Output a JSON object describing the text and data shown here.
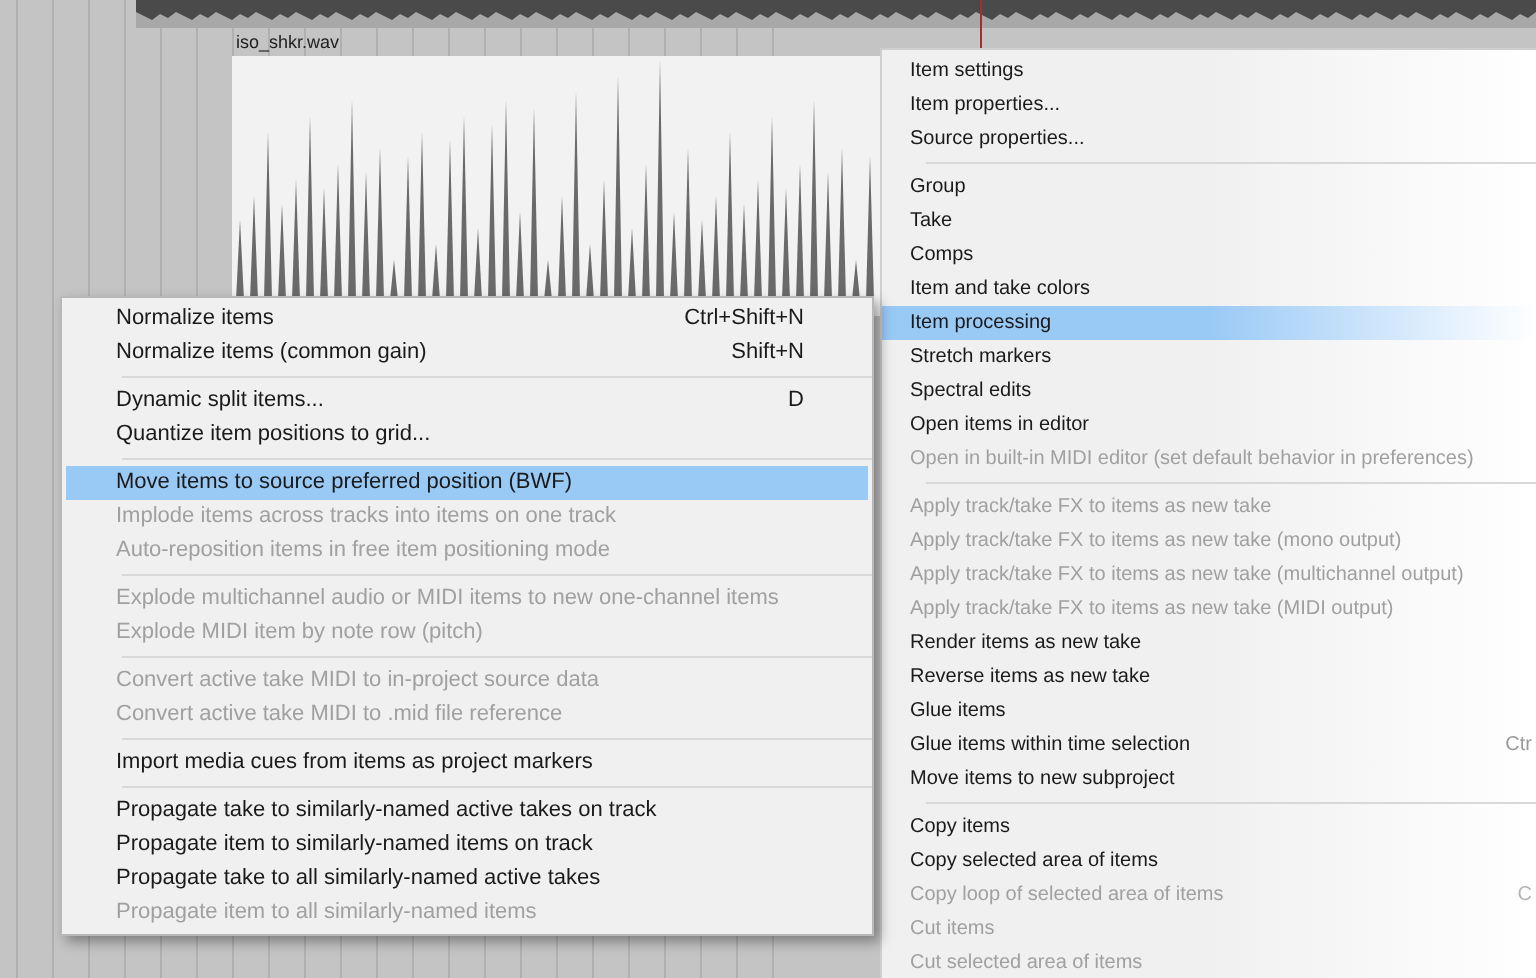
{
  "item_label": "iso_shkr.wav",
  "submenu": {
    "items": [
      {
        "kind": "item",
        "label": "Normalize items",
        "shortcut": "Ctrl+Shift+N",
        "disabled": false,
        "selected": false
      },
      {
        "kind": "item",
        "label": "Normalize items (common gain)",
        "shortcut": "Shift+N",
        "disabled": false,
        "selected": false
      },
      {
        "kind": "separator"
      },
      {
        "kind": "item",
        "label": "Dynamic split items...",
        "shortcut": "D",
        "disabled": false,
        "selected": false
      },
      {
        "kind": "item",
        "label": "Quantize item positions to grid...",
        "disabled": false,
        "selected": false
      },
      {
        "kind": "separator"
      },
      {
        "kind": "item",
        "label": "Move items to source preferred position (BWF)",
        "disabled": false,
        "selected": true
      },
      {
        "kind": "item",
        "label": "Implode items across tracks into items on one track",
        "disabled": true,
        "selected": false
      },
      {
        "kind": "item",
        "label": "Auto-reposition items in free item positioning mode",
        "disabled": true,
        "selected": false
      },
      {
        "kind": "separator"
      },
      {
        "kind": "item",
        "label": "Explode multichannel audio or MIDI items to new one-channel items",
        "disabled": true,
        "selected": false
      },
      {
        "kind": "item",
        "label": "Explode MIDI item by note row (pitch)",
        "disabled": true,
        "selected": false
      },
      {
        "kind": "separator"
      },
      {
        "kind": "item",
        "label": "Convert active take MIDI to in-project source data",
        "disabled": true,
        "selected": false
      },
      {
        "kind": "item",
        "label": "Convert active take MIDI to .mid file reference",
        "disabled": true,
        "selected": false
      },
      {
        "kind": "separator"
      },
      {
        "kind": "item",
        "label": "Import media cues from items as project markers",
        "disabled": false,
        "selected": false
      },
      {
        "kind": "separator"
      },
      {
        "kind": "item",
        "label": "Propagate take to similarly-named active takes on track",
        "disabled": false,
        "selected": false
      },
      {
        "kind": "item",
        "label": "Propagate item to similarly-named items on track",
        "disabled": false,
        "selected": false
      },
      {
        "kind": "item",
        "label": "Propagate take to all similarly-named active takes",
        "disabled": false,
        "selected": false
      },
      {
        "kind": "item",
        "label": "Propagate item to all similarly-named items",
        "disabled": true,
        "selected": false
      }
    ]
  },
  "context_menu": {
    "items": [
      {
        "kind": "item",
        "label": "Item settings",
        "disabled": false,
        "selected": false
      },
      {
        "kind": "item",
        "label": "Item properties...",
        "disabled": false,
        "selected": false
      },
      {
        "kind": "item",
        "label": "Source properties...",
        "disabled": false,
        "selected": false
      },
      {
        "kind": "separator"
      },
      {
        "kind": "item",
        "label": "Group",
        "disabled": false,
        "selected": false
      },
      {
        "kind": "item",
        "label": "Take",
        "disabled": false,
        "selected": false
      },
      {
        "kind": "item",
        "label": "Comps",
        "disabled": false,
        "selected": false
      },
      {
        "kind": "item",
        "label": "Item and take colors",
        "disabled": false,
        "selected": false
      },
      {
        "kind": "item",
        "label": "Item processing",
        "disabled": false,
        "selected": true
      },
      {
        "kind": "item",
        "label": "Stretch markers",
        "disabled": false,
        "selected": false
      },
      {
        "kind": "item",
        "label": "Spectral edits",
        "disabled": false,
        "selected": false
      },
      {
        "kind": "item",
        "label": "Open items in editor",
        "disabled": false,
        "selected": false
      },
      {
        "kind": "item",
        "label": "Open in built-in MIDI editor (set default behavior in preferences)",
        "disabled": true,
        "selected": false
      },
      {
        "kind": "separator"
      },
      {
        "kind": "item",
        "label": "Apply track/take FX to items as new take",
        "disabled": true,
        "selected": false
      },
      {
        "kind": "item",
        "label": "Apply track/take FX to items as new take (mono output)",
        "disabled": true,
        "selected": false
      },
      {
        "kind": "item",
        "label": "Apply track/take FX to items as new take (multichannel output)",
        "disabled": true,
        "selected": false
      },
      {
        "kind": "item",
        "label": "Apply track/take FX to items as new take (MIDI output)",
        "disabled": true,
        "selected": false
      },
      {
        "kind": "item",
        "label": "Render items as new take",
        "disabled": false,
        "selected": false
      },
      {
        "kind": "item",
        "label": "Reverse items as new take",
        "disabled": false,
        "selected": false
      },
      {
        "kind": "item",
        "label": "Glue items",
        "disabled": false,
        "selected": false
      },
      {
        "kind": "item",
        "label": "Glue items within time selection",
        "shortcut": "Ctr",
        "disabled": false,
        "selected": false
      },
      {
        "kind": "item",
        "label": "Move items to new subproject",
        "disabled": false,
        "selected": false
      },
      {
        "kind": "separator"
      },
      {
        "kind": "item",
        "label": "Copy items",
        "disabled": false,
        "selected": false
      },
      {
        "kind": "item",
        "label": "Copy selected area of items",
        "disabled": false,
        "selected": false
      },
      {
        "kind": "item",
        "label": "Copy loop of selected area of items",
        "shortcut": "C",
        "disabled": true,
        "selected": false
      },
      {
        "kind": "item",
        "label": "Cut items",
        "disabled": true,
        "selected": false
      },
      {
        "kind": "item",
        "label": "Cut selected area of items",
        "disabled": true,
        "selected": false
      }
    ]
  }
}
